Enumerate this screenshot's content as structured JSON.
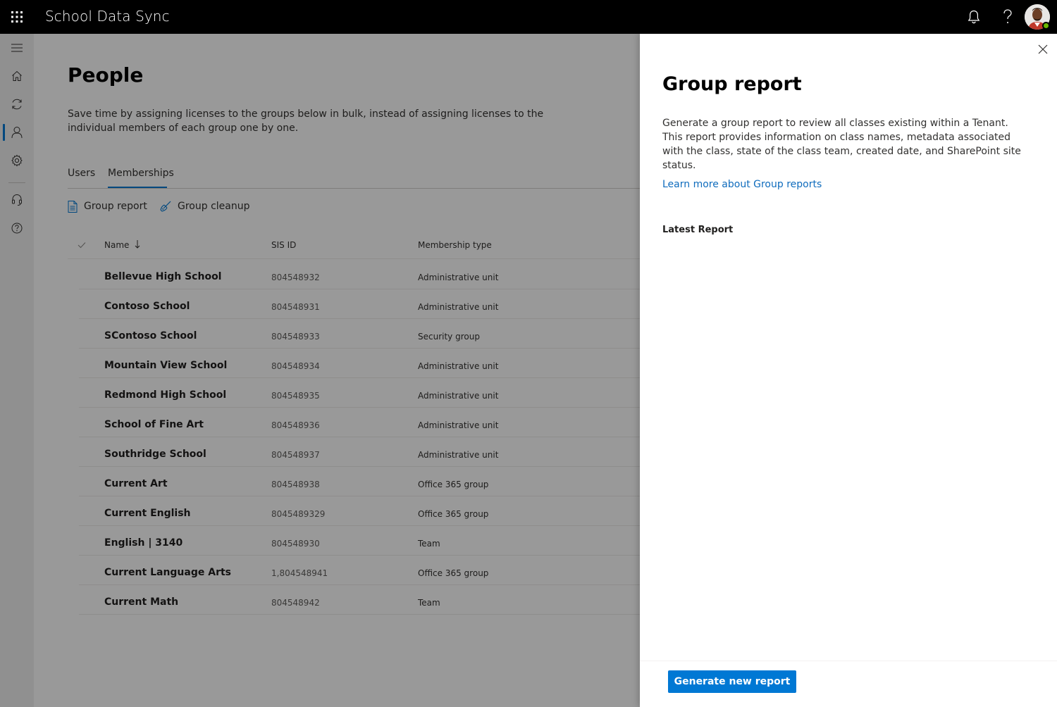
{
  "app": {
    "title": "School Data Sync"
  },
  "topbar": {
    "icons": [
      "waffle-icon",
      "bell-icon",
      "help-icon",
      "avatar"
    ]
  },
  "leftrail": {
    "items": [
      "menu-icon",
      "home-icon",
      "sync-icon",
      "people-icon",
      "settings-icon",
      "support-icon",
      "help-circle-icon"
    ],
    "active": "people-icon"
  },
  "page": {
    "title": "People",
    "description": "Save time by assigning licenses to the groups below in bulk, instead of assigning licenses to the individual members of each group one by one.",
    "tabs": [
      {
        "label": "Users"
      },
      {
        "label": "Memberships"
      }
    ],
    "active_tab": "Memberships",
    "commands": [
      {
        "label": "Group report",
        "icon": "document-icon"
      },
      {
        "label": "Group cleanup",
        "icon": "broom-icon"
      }
    ]
  },
  "grid": {
    "columns": {
      "name": "Name",
      "sis_id": "SIS ID",
      "membership_type": "Membership type"
    },
    "sort": "Name descending-arrow",
    "rows": [
      {
        "name": "Bellevue High School",
        "sis_id": "804548932",
        "type": "Administrative unit"
      },
      {
        "name": "Contoso School",
        "sis_id": "804548931",
        "type": "Administrative unit"
      },
      {
        "name": "SContoso School",
        "sis_id": "804548933",
        "type": "Security group"
      },
      {
        "name": "Mountain View School",
        "sis_id": "804548934",
        "type": "Administrative unit"
      },
      {
        "name": "Redmond High School",
        "sis_id": "804548935",
        "type": "Administrative unit"
      },
      {
        "name": "School of Fine Art",
        "sis_id": "804548936",
        "type": "Administrative unit"
      },
      {
        "name": "Southridge School",
        "sis_id": "804548937",
        "type": "Administrative unit"
      },
      {
        "name": "Current Art",
        "sis_id": "804548938",
        "type": "Office 365 group"
      },
      {
        "name": "Current English",
        "sis_id": "8045489329",
        "type": "Office 365 group"
      },
      {
        "name": "English | 3140",
        "sis_id": "804548930",
        "type": "Team"
      },
      {
        "name": "Current Language Arts",
        "sis_id": "1,804548941",
        "type": "Office 365 group"
      },
      {
        "name": "Current Math",
        "sis_id": "804548942",
        "type": "Team"
      }
    ]
  },
  "panel": {
    "title": "Group report",
    "description": "Generate a group report to review all classes existing within a Tenant. This report provides information on class names, metadata associated with the class, state of the class team, created date, and SharePoint site status.",
    "link": "Learn more about Group reports",
    "section": "Latest Report",
    "primary_button": "Generate new report",
    "accent": "#0078d4"
  }
}
